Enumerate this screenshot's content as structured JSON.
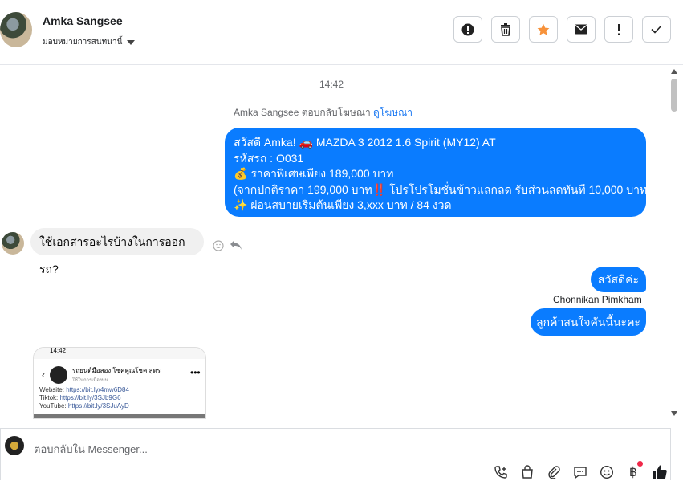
{
  "header": {
    "name": "Amka Sangsee",
    "assign_label": "มอบหมายการสนทนานี้"
  },
  "toolbar": {
    "buttons": [
      {
        "icon": "alert-circle-icon",
        "label": "report"
      },
      {
        "icon": "trash-icon",
        "label": "delete"
      },
      {
        "icon": "star-icon",
        "label": "star"
      },
      {
        "icon": "mail-icon",
        "label": "mark unread"
      },
      {
        "icon": "exclamation-icon",
        "label": "spam"
      },
      {
        "icon": "check-icon",
        "label": "done"
      }
    ],
    "star_color": "#f7923a"
  },
  "conversation": {
    "timestamp": "14:42",
    "reply_note": "Amka Sangsee ตอบกลับโฆษณา",
    "reply_note_link": "ดูโฆษณา",
    "ad_message": {
      "line1": "สวัสดี Amka! 🚗 MAZDA 3 2012 1.6 Spirit (MY12) AT",
      "line2": " รหัสรถ : O031",
      "line3": "💰 ราคาพิเศษเพียง 189,000 บาท",
      "line4": "(จากปกติราคา 199,000 บาท‼️ โปรโปรโมชั่นข้าวแลกลด รับส่วนลดทันที 10,000 บาท)",
      "line5": "✨ ผ่อนสบายเริ่มต้นเพียง 3,xxx บาท / 84 งวด"
    },
    "incoming_question": "ใช้เอกสารอะไรบ้างในการออกรถ?",
    "outgoing_greeting": "สวัสดีค่ะ",
    "sender_name": "Chonnikan Pimkham",
    "outgoing_interest": "ลูกค้าสนใจคันนี้นะคะ",
    "card": {
      "status_time": "14:42",
      "page_name": "รถยนต์มือสอง โชคคูณโชค ลุดร",
      "page_sub": "ใช้ในการเมืองบน",
      "links": [
        {
          "label": "Website: ",
          "url": "https://bit.ly/4mw6D84"
        },
        {
          "label": "Tiktok: ",
          "url": "https://bit.ly/3SJb9G6"
        },
        {
          "label": "YouTube: ",
          "url": "https://bit.ly/3SJuAyD"
        }
      ]
    }
  },
  "composer": {
    "placeholder": "ตอบกลับใน Messenger...",
    "icons": [
      "phone-plus-icon",
      "shopping-bag-icon",
      "paperclip-icon",
      "saved-replies-icon",
      "emoji-icon",
      "baht-icon",
      "thumbs-up-icon"
    ]
  },
  "colors": {
    "outgoing_bubble": "#0a7cff",
    "incoming_bubble": "#f0f0f0",
    "link": "#1877f2"
  }
}
